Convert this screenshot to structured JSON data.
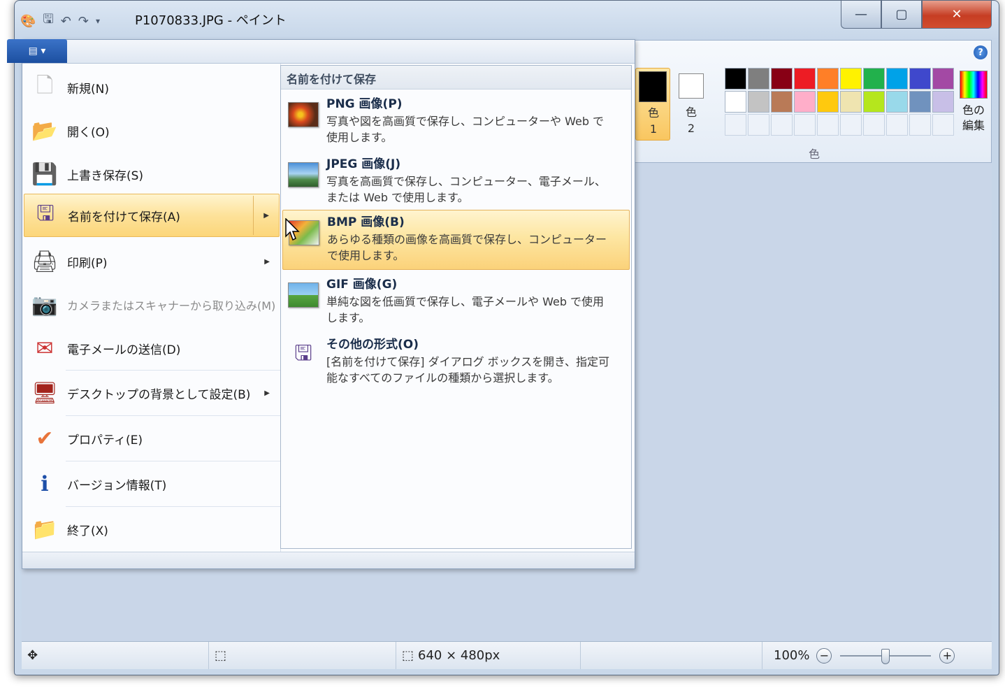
{
  "window": {
    "title": "P1070833.JPG - ペイント",
    "min_icon": "—",
    "max_icon": "▢",
    "close_icon": "✕"
  },
  "ribbon": {
    "file_tab_icon": "▤ ▾",
    "help": "?",
    "colors": {
      "color1_label": "色\n1",
      "color2_label": "色\n2",
      "edit_label": "色の\n編集",
      "group_label": "色",
      "palette_row1": [
        "#000000",
        "#7f7f7f",
        "#880015",
        "#ed1c24",
        "#ff7f27",
        "#fff200",
        "#22b14c",
        "#00a2e8",
        "#3f48cc",
        "#a349a4"
      ],
      "palette_row2": [
        "#ffffff",
        "#c3c3c3",
        "#b97a57",
        "#ffaec9",
        "#ffc90e",
        "#efe4b0",
        "#b5e61d",
        "#99d9ea",
        "#7092be",
        "#c8bfe7"
      ]
    }
  },
  "file_menu": {
    "items": [
      {
        "label": "新規(N)",
        "icon": "new-document-icon",
        "glyph": "🗋"
      },
      {
        "label": "開く(O)",
        "icon": "open-folder-icon",
        "glyph": "📂"
      },
      {
        "label": "上書き保存(S)",
        "icon": "save-disk-icon",
        "glyph": "💾"
      },
      {
        "label": "名前を付けて保存(A)",
        "icon": "save-as-icon",
        "glyph": "🖫"
      },
      {
        "label": "印刷(P)",
        "icon": "printer-icon",
        "glyph": "🖨"
      },
      {
        "label": "カメラまたはスキャナーから取り込み(M)",
        "icon": "scanner-icon",
        "glyph": "📷"
      },
      {
        "label": "電子メールの送信(D)",
        "icon": "email-icon",
        "glyph": "✉"
      },
      {
        "label": "デスクトップの背景として設定(B)",
        "icon": "desktop-icon",
        "glyph": "🖥"
      },
      {
        "label": "プロパティ(E)",
        "icon": "checkmark-icon",
        "glyph": "✔"
      },
      {
        "label": "バージョン情報(T)",
        "icon": "info-icon",
        "glyph": "ℹ"
      },
      {
        "label": "終了(X)",
        "icon": "exit-icon",
        "glyph": "📁"
      }
    ],
    "submenu": {
      "header": "名前を付けて保存",
      "items": [
        {
          "title": "PNG 画像(P)",
          "desc": "写真や図を高画質で保存し、コンピューターや Web で使用します。"
        },
        {
          "title": "JPEG 画像(J)",
          "desc": "写真を高画質で保存し、コンピューター、電子メール、または Web で使用します。"
        },
        {
          "title": "BMP 画像(B)",
          "desc": "あらゆる種類の画像を高画質で保存し、コンピューターで使用します。"
        },
        {
          "title": "GIF 画像(G)",
          "desc": "単純な図を低画質で保存し、電子メールや Web で使用します。"
        },
        {
          "title": "その他の形式(O)",
          "desc": "[名前を付けて保存] ダイアログ ボックスを開き、指定可能なすべてのファイルの種類から選択します。"
        }
      ]
    }
  },
  "statusbar": {
    "move_icon": "✥",
    "selection_icon": "⬚",
    "size_icon": "⬚",
    "image_size": "640 × 480px",
    "zoom": "100%",
    "zoom_out": "−",
    "zoom_in": "+",
    "zoom_level": 0.5
  }
}
